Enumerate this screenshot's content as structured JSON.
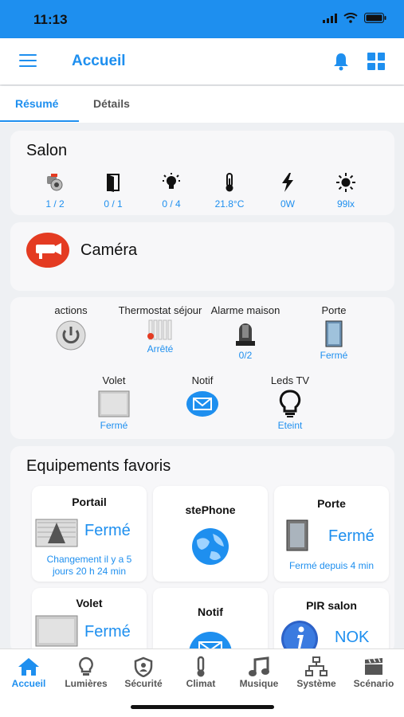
{
  "status_bar": {
    "time": "11:13"
  },
  "header": {
    "title": "Accueil"
  },
  "tabs": [
    {
      "label": "Résumé"
    },
    {
      "label": "Détails"
    }
  ],
  "salon": {
    "name": "Salon",
    "stats": [
      {
        "icon": "camera-icon",
        "value": "1 / 2"
      },
      {
        "icon": "door-icon",
        "value": "0 / 1"
      },
      {
        "icon": "bulb-icon",
        "value": "0 / 4"
      },
      {
        "icon": "thermometer-icon",
        "value": "21.8°C"
      },
      {
        "icon": "lightning-icon",
        "value": "0W"
      },
      {
        "icon": "sun-icon",
        "value": "99lx"
      }
    ]
  },
  "camera_card": {
    "label": "Caméra"
  },
  "actions": [
    {
      "label": "actions",
      "sub": ""
    },
    {
      "label": "Thermostat séjour",
      "sub": "Arrêté"
    },
    {
      "label": "Alarme maison",
      "sub": "0/2"
    },
    {
      "label": "Porte",
      "sub": "Fermé"
    },
    {
      "label": "Volet",
      "sub": "Fermé"
    },
    {
      "label": "Notif",
      "sub": ""
    },
    {
      "label": "Leds TV",
      "sub": "Eteint"
    }
  ],
  "favoris": {
    "title": "Equipements favoris",
    "tiles": [
      {
        "title": "Portail",
        "state": "Fermé",
        "foot": "Changement il y a 5 jours 20 h 24 min"
      },
      {
        "title": "stePhone",
        "state": "",
        "foot": ""
      },
      {
        "title": "Porte",
        "state": "Fermé",
        "foot": "Fermé depuis 4 min"
      },
      {
        "title": "Volet",
        "state": "Fermé",
        "foot": ""
      },
      {
        "title": "Notif",
        "state": "",
        "foot": ""
      },
      {
        "title": "PIR salon",
        "state": "NOK",
        "foot": ""
      }
    ]
  },
  "nav": [
    {
      "label": "Accueil"
    },
    {
      "label": "Lumières"
    },
    {
      "label": "Sécurité"
    },
    {
      "label": "Climat"
    },
    {
      "label": "Musique"
    },
    {
      "label": "Système"
    },
    {
      "label": "Scénario"
    }
  ],
  "colors": {
    "accent": "#1e8fef",
    "camera_badge": "#e43b22"
  }
}
